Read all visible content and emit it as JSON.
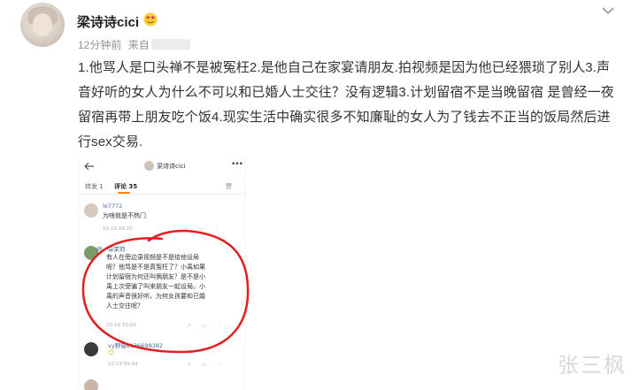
{
  "post": {
    "username": "梁诗诗cici",
    "time": "12分钟前",
    "source_prefix": "来自",
    "body": "1.他骂人是口头禅不是被冤枉2.是他自己在家宴请朋友.拍视频是因为他已经猥琐了别人3.声音好听的女人为什么不可以和已婚人士交往？没有逻辑3.计划留宿不是当晚留宿 是曾经一夜留宿再带上朋友吃个饭4.现实生活中确实很多不知廉耻的女人为了钱去不正当的饭局然后进行sex交易.",
    "badge_icon": "heart-eyes-emoji-icon",
    "options_icon": "chevron-down-icon"
  },
  "screenshot": {
    "header_name": "梁诗诗cici",
    "tab_repost": "转发 1",
    "tab_comments": "评论 35",
    "tab_likes": "赞",
    "comments": [
      {
        "user": "le7772",
        "text": "为啥就是不热门",
        "time": "10-19 09:20"
      },
      {
        "user": "好一朵茉莉",
        "lines": [
          "有人在旁边录视频是不是给他设局",
          "呢？他骂是不是真冤枉了？小禹如果",
          "计划留宿为何还叫俩朋友？是不是小",
          "禹上次受骗了叫来朋友一起设局。小",
          "禹的声音很好听，为何女孩要和已婚",
          "人士交往呢？"
        ],
        "time": "10-19 10:03"
      },
      {
        "user": "vy野猫8136699382",
        "time": "10-19 09:54"
      }
    ]
  },
  "watermark": "张三枫",
  "colors": {
    "accent": "#ff8200",
    "annotation": "#e02020",
    "link": "#4a6d97"
  }
}
